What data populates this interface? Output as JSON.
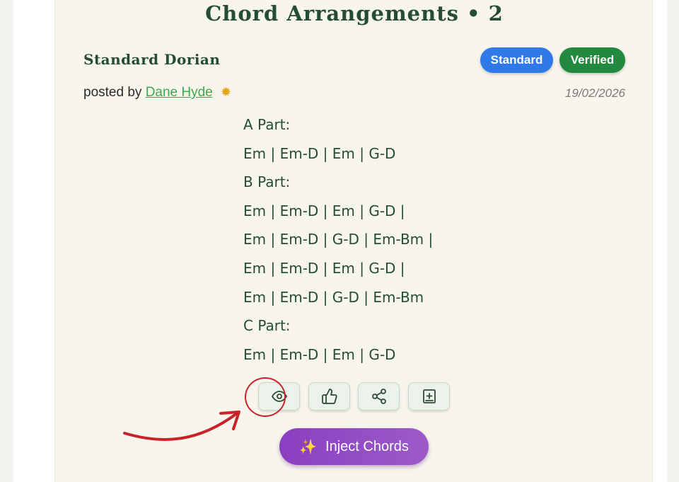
{
  "card": {
    "title": "Chord Arrangements • 2",
    "arrangement_name": "Standard Dorian",
    "badges": {
      "standard": "Standard",
      "verified": "Verified"
    },
    "posted_prefix": "posted by",
    "author": "Dane Hyde",
    "date": "19/02/2026",
    "chord_lines": [
      "A Part:",
      "Em | Em-D | Em | G-D",
      "B Part:",
      "Em | Em-D | Em | G-D |",
      "Em | Em-D | G-D | Em-Bm |",
      "Em | Em-D | Em | G-D |",
      "Em | Em-D | G-D | Em-Bm",
      "C Part:",
      "Em | Em-D | Em | G-D"
    ],
    "actions": {
      "view_icon": "eye-icon",
      "like_icon": "thumbs-up-icon",
      "share_icon": "share-icon",
      "add_icon": "add-to-book-icon"
    },
    "inject_button": "Inject Chords"
  },
  "annotation": {
    "color": "#c8232a"
  },
  "colors": {
    "title": "#244d33",
    "standard_badge": "#2f7ae8",
    "verified_badge": "#23893f",
    "author_link": "#3fa84f",
    "inject_button": "#8a3fc0"
  }
}
